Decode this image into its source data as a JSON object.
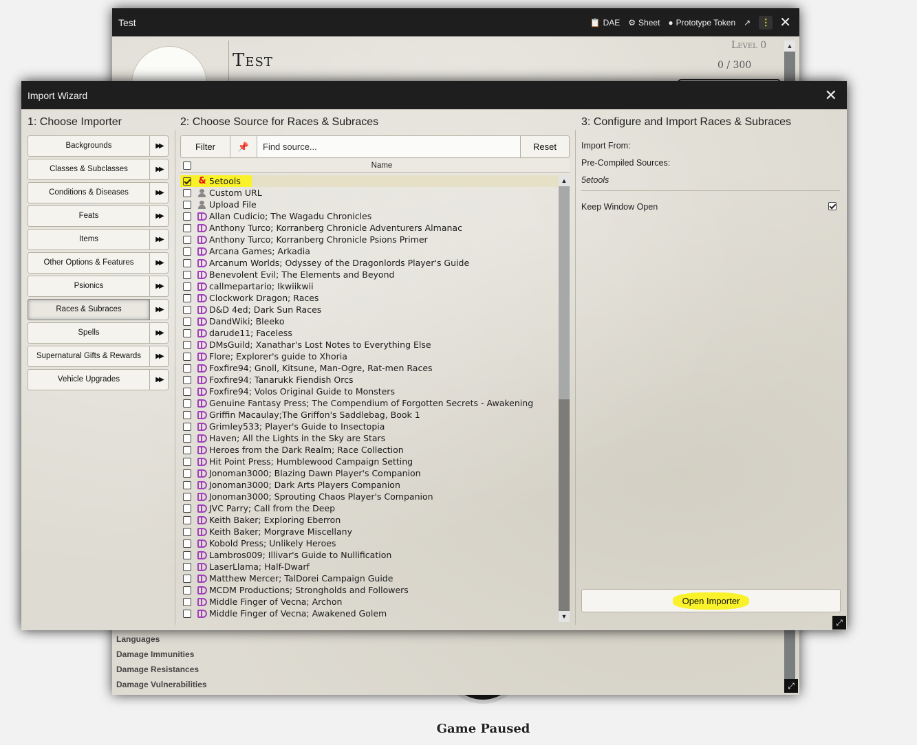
{
  "background": {
    "paused_label": "Game Paused"
  },
  "sheet": {
    "title": "Test",
    "header_buttons": [
      {
        "label": "DAE",
        "icon": "clipboard-icon"
      },
      {
        "label": "Sheet",
        "icon": "gear-icon"
      },
      {
        "label": "Prototype Token",
        "icon": "user-circle-icon"
      }
    ],
    "name": "Test",
    "level": "Level 0",
    "xp": "0 / 300",
    "traits": [
      "Languages",
      "Damage Immunities",
      "Damage Resistances",
      "Damage Vulnerabilities"
    ]
  },
  "wizard": {
    "title": "Import Wizard",
    "col1_title": "1: Choose Importer",
    "importers": [
      "Backgrounds",
      "Classes & Subclasses",
      "Conditions & Diseases",
      "Feats",
      "Items",
      "Other Options & Features",
      "Psionics",
      "Races & Subraces",
      "Spells",
      "Supernatural Gifts & Rewards",
      "Vehicle Upgrades"
    ],
    "active_importer_index": 7,
    "col2_title": "2: Choose Source for Races & Subraces",
    "filter_label": "Filter",
    "search_placeholder": "Find source...",
    "reset_label": "Reset",
    "name_header": "Name",
    "sources": [
      "5etools",
      "Custom URL",
      "Upload File",
      "Allan Cudicio; The Wagadu Chronicles",
      "Anthony Turco; Korranberg Chronicle Adventurers Almanac",
      "Anthony Turco; Korranberg Chronicle Psions Primer",
      "Arcana Games; Arkadia",
      "Arcanum Worlds; Odyssey of the Dragonlords Player's Guide",
      "Benevolent Evil; The Elements and Beyond",
      "callmepartario; Ikwiikwii",
      "Clockwork Dragon; Races",
      "D&D 4ed; Dark Sun Races",
      "DandWiki; Bleeko",
      "darude11; Faceless",
      "DMsGuild; Xanathar's Lost Notes to Everything Else",
      "Flore; Explorer's guide to Xhoria",
      "Foxfire94; Gnoll, Kitsune, Man-Ogre, Rat-men Races",
      "Foxfire94; Tanarukk Fiendish Orcs",
      "Foxfire94; Volos Original Guide to Monsters",
      "Genuine Fantasy Press; The Compendium of Forgotten Secrets - Awakening",
      "Griffin Macaulay;The Griffon's Saddlebag, Book 1",
      "Grimley533; Player's Guide to Insectopia",
      "Haven; All the Lights in the Sky are Stars",
      "Heroes from the Dark Realm; Race Collection",
      "Hit Point Press; Humblewood Campaign Setting",
      "Jonoman3000; Blazing Dawn Player's Companion",
      "Jonoman3000; Dark Arts Players Companion",
      "Jonoman3000; Sprouting Chaos Player's Companion",
      "JVC Parry; Call from the Deep",
      "Keith Baker; Exploring Eberron",
      "Keith Baker; Morgrave Miscellany",
      "Kobold Press; Unlikely Heroes",
      "Lambros009; Illivar's Guide to Nullification",
      "LaserLlama; Half-Dwarf",
      "Matthew Mercer; TalDorei Campaign Guide",
      "MCDM Productions; Strongholds and Followers",
      "Middle Finger of Vecna; Archon",
      "Middle Finger of Vecna; Awakened Golem"
    ],
    "selected_source_index": 0,
    "col3_title": "3: Configure and Import Races & Subraces",
    "import_from_label": "Import From:",
    "precompiled_label": "Pre-Compiled Sources:",
    "selected_source": "5etools",
    "keep_open_label": "Keep Window Open",
    "keep_open_checked": true,
    "open_importer_label": "Open Importer"
  }
}
